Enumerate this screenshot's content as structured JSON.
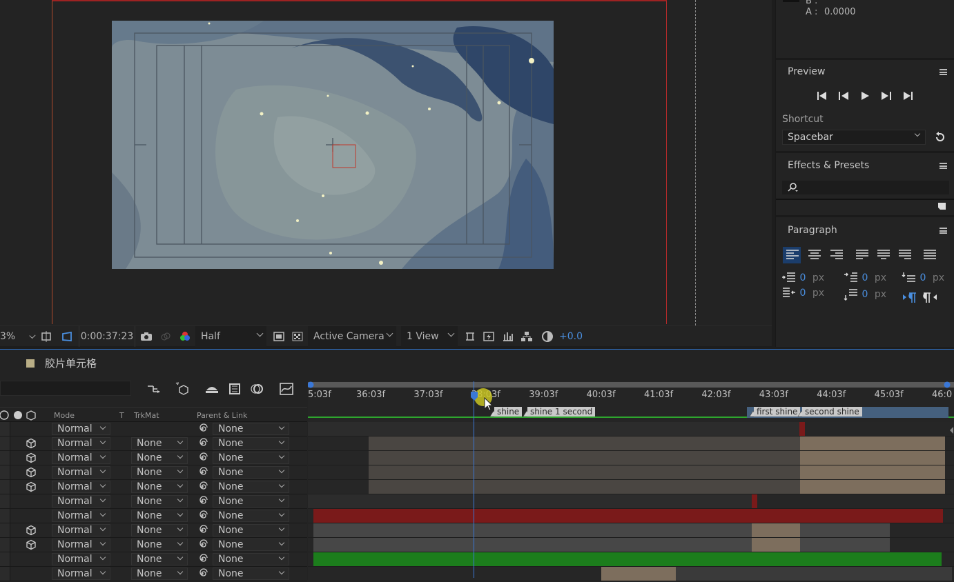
{
  "viewer": {
    "zoom": "3%",
    "timecode": "0:00:37:23",
    "resolution": "Half",
    "camera": "Active Camera",
    "views": "1 View",
    "exposure": "+0.0"
  },
  "info": {
    "b_label": "B :",
    "a_label": "A :",
    "a_value": "0.0000"
  },
  "preview": {
    "title": "Preview",
    "shortcut_label": "Shortcut",
    "shortcut_value": "Spacebar"
  },
  "effects": {
    "title": "Effects & Presets",
    "search_placeholder": ""
  },
  "paragraph": {
    "title": "Paragraph",
    "indent_left": "0",
    "indent_right": "0",
    "first_line": "0",
    "space_before": "0",
    "space_after": "0",
    "unit": "px"
  },
  "timeline": {
    "comp_name": "胶片单元格",
    "columns": {
      "mode": "Mode",
      "t": "T",
      "trkmat": "TrkMat",
      "parent": "Parent & Link"
    },
    "rows": [
      {
        "mode": "Normal",
        "trkmat": "",
        "parent": "None",
        "is3d": false
      },
      {
        "mode": "Normal",
        "trkmat": "None",
        "parent": "None",
        "is3d": true
      },
      {
        "mode": "Normal",
        "trkmat": "None",
        "parent": "None",
        "is3d": true
      },
      {
        "mode": "Normal",
        "trkmat": "None",
        "parent": "None",
        "is3d": true
      },
      {
        "mode": "Normal",
        "trkmat": "None",
        "parent": "None",
        "is3d": true
      },
      {
        "mode": "Normal",
        "trkmat": "None",
        "parent": "None",
        "is3d": false
      },
      {
        "mode": "Normal",
        "trkmat": "None",
        "parent": "None",
        "is3d": false
      },
      {
        "mode": "Normal",
        "trkmat": "None",
        "parent": "None",
        "is3d": true
      },
      {
        "mode": "Normal",
        "trkmat": "None",
        "parent": "None",
        "is3d": true
      },
      {
        "mode": "Normal",
        "trkmat": "None",
        "parent": "None",
        "is3d": false
      },
      {
        "mode": "Normal",
        "trkmat": "None",
        "parent": "None",
        "is3d": false
      }
    ],
    "ruler": [
      "5:03f",
      "36:03f",
      "37:03f",
      "38:03f",
      "39:03f",
      "40:03f",
      "41:03f",
      "42:03f",
      "43:03f",
      "44:03f",
      "45:03f",
      "46:0"
    ],
    "markers": [
      "shine",
      "shine 1 second",
      "first shine",
      "second shine"
    ]
  },
  "colors": {
    "accent": "#3a78d8",
    "red_layer": "#7a1a1a",
    "green_layer": "#1c7d1c",
    "tan_layer": "#7d6e5d"
  }
}
